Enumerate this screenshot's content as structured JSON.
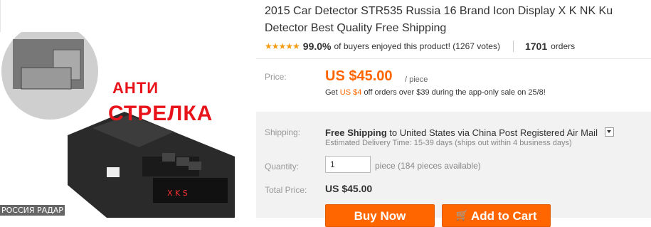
{
  "product": {
    "title_line1": "2015 Car Detector STR535 Russia 16 Brand Icon Display X K NK Ku",
    "title_line2": "Detector Best Quality Free Shipping",
    "image_text_1": "АНТИ",
    "image_text_2": "СТРЕЛКА",
    "image_caption": "РОССИЯ РАДАР"
  },
  "rating": {
    "stars": "★★★★★",
    "percent": "99.0%",
    "percent_text": "of buyers enjoyed this product! (1267 votes)",
    "orders": "1701",
    "orders_label": "orders"
  },
  "price": {
    "label": "Price:",
    "value": "US $45.00",
    "unit": "/ piece",
    "promo_prefix": "Get",
    "promo_amount": "US $4",
    "promo_suffix": "off orders over $39 during the app-only sale on 25/8!"
  },
  "shipping": {
    "label": "Shipping:",
    "free": "Free Shipping",
    "to": "to",
    "destination": "United States via China Post Registered Air Mail",
    "estimate": "Estimated Delivery Time: 15-39 days (ships out within 4 business days)"
  },
  "quantity": {
    "label": "Quantity:",
    "value": "1",
    "available": "piece (184 pieces available)"
  },
  "total": {
    "label": "Total Price:",
    "value": "US $45.00"
  },
  "actions": {
    "buy_now": "Buy Now",
    "add_to_cart": "Add to Cart"
  },
  "colors": {
    "accent": "#ff6600",
    "star": "#f39c12",
    "image_text": "#e8141b"
  }
}
